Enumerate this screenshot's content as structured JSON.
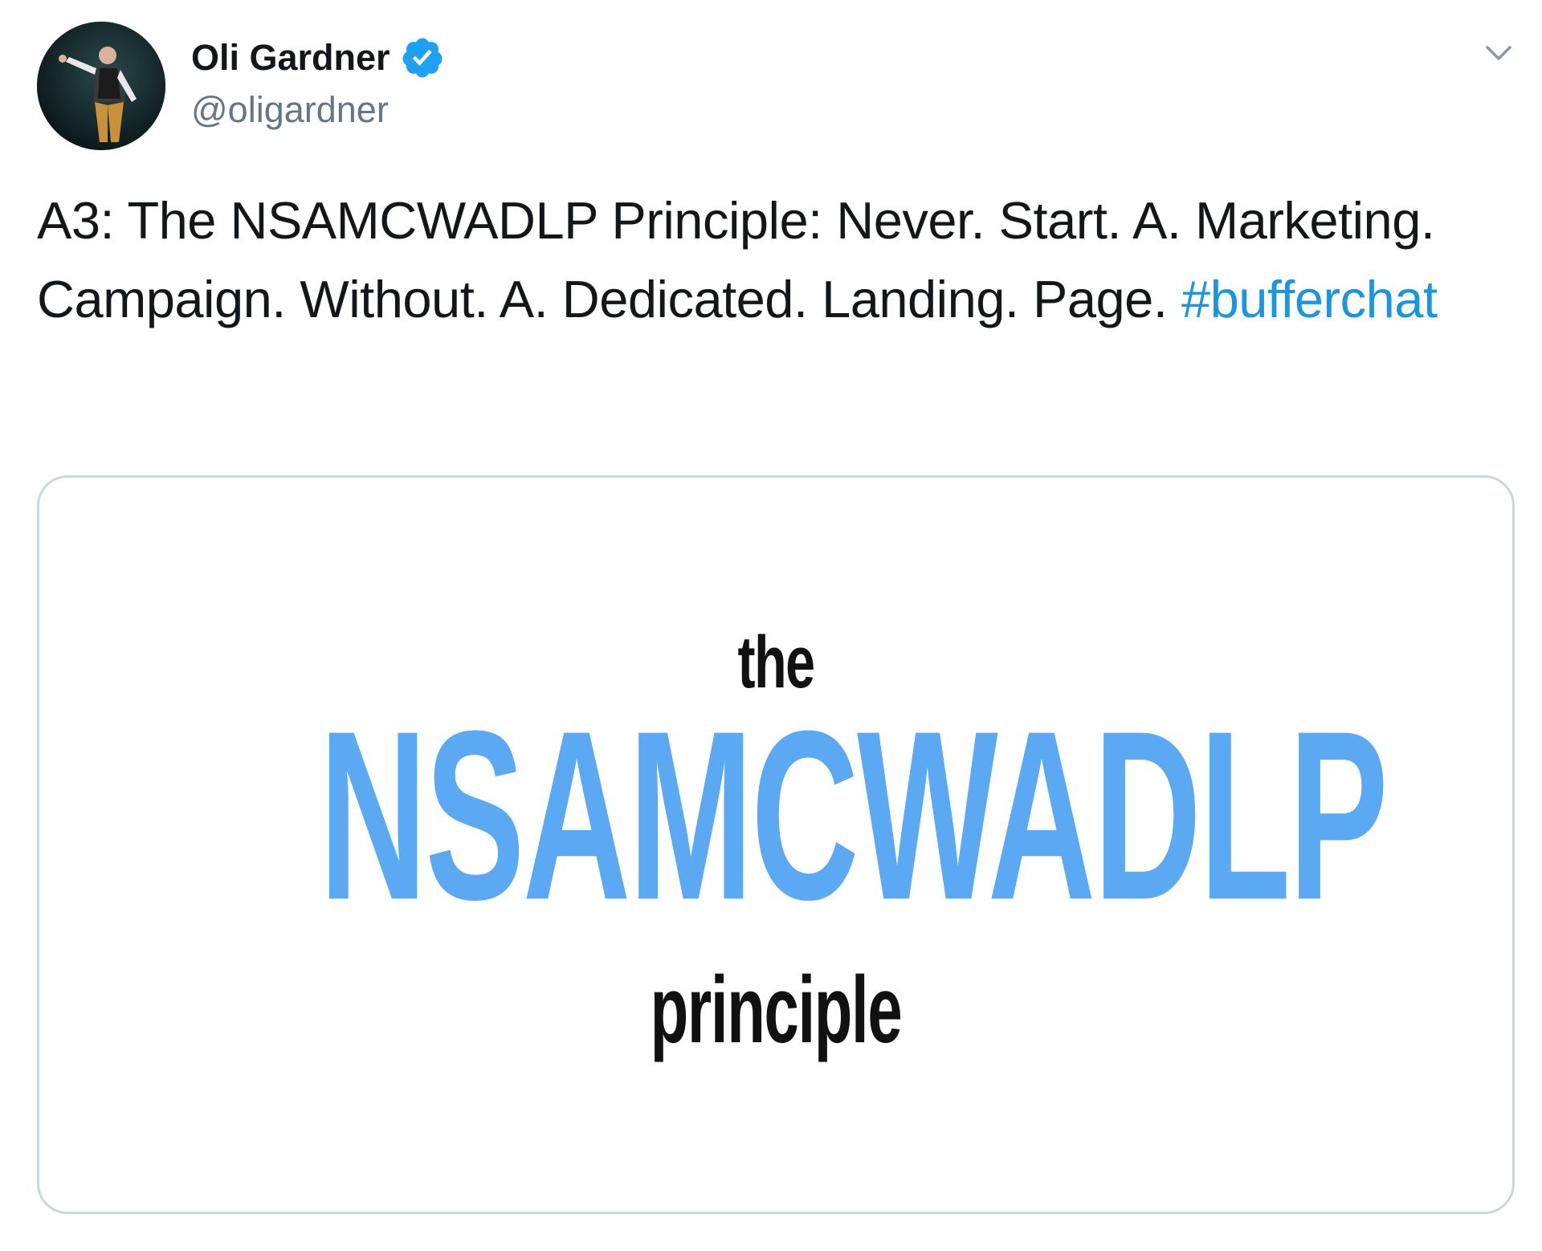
{
  "author": {
    "display_name": "Oli Gardner",
    "handle": "@oligardner",
    "verified_icon": "verified-badge-icon",
    "avatar_icon": "profile-photo"
  },
  "menu": {
    "icon": "chevron-down-icon"
  },
  "tweet": {
    "text": "A3: The NSAMCWADLP Principle: Never. Start. A. Marketing. Campaign. Without. A. Dedicated. Landing. Page. ",
    "hashtag": "#bufferchat"
  },
  "media": {
    "word_top": "the",
    "acronym": "NSAMCWADLP",
    "word_bottom": "principle"
  },
  "colors": {
    "text": "#14171a",
    "secondary": "#657786",
    "link": "#1b95e0",
    "verified": "#1da1f2",
    "acronym": "#5ba9f2",
    "card_border": "#ccd6dd"
  }
}
